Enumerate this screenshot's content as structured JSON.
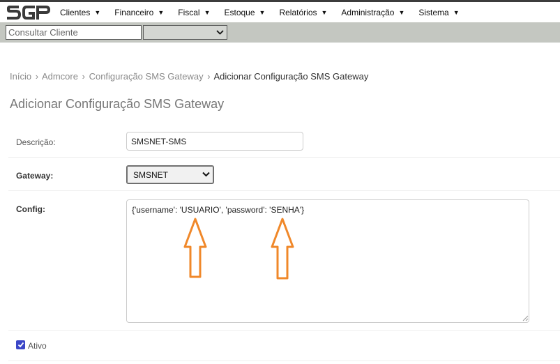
{
  "brand": {
    "logo_text": "SGP",
    "accent": "#333333"
  },
  "menu": [
    {
      "label": "Clientes"
    },
    {
      "label": "Financeiro"
    },
    {
      "label": "Fiscal"
    },
    {
      "label": "Estoque"
    },
    {
      "label": "Relatórios"
    },
    {
      "label": "Administração"
    },
    {
      "label": "Sistema"
    }
  ],
  "search": {
    "placeholder": "Consultar Cliente",
    "value": "",
    "select_value": ""
  },
  "breadcrumb": [
    {
      "label": "Início"
    },
    {
      "label": "Admcore"
    },
    {
      "label": "Configuração SMS Gateway"
    },
    {
      "label": "Adicionar Configuração SMS Gateway"
    }
  ],
  "breadcrumb_separator": "›",
  "page_title": "Adicionar Configuração SMS Gateway",
  "form": {
    "descricao": {
      "label": "Descrição:",
      "value": "SMSNET-SMS"
    },
    "gateway": {
      "label": "Gateway:",
      "value": "SMSNET"
    },
    "config": {
      "label": "Config:",
      "value": "{'username': 'USUARIO', 'password': 'SENHA'}"
    },
    "ativo": {
      "label": "Ativo",
      "checked": true
    }
  },
  "annotation_color": "#f0882a"
}
